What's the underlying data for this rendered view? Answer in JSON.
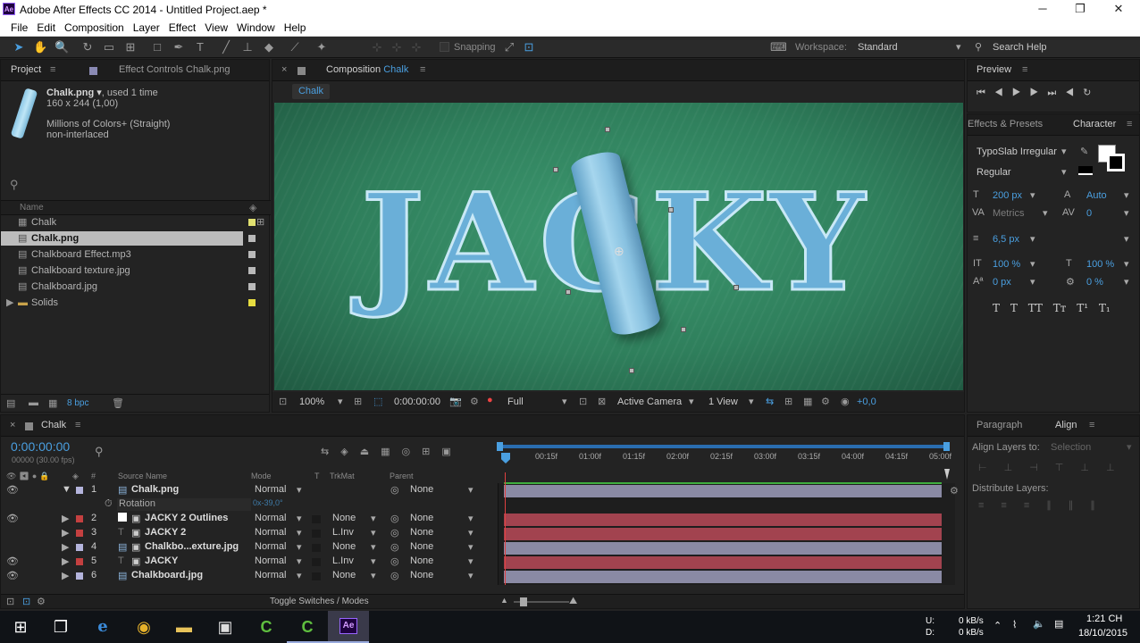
{
  "window": {
    "app_icon": "Ae",
    "title": "Adobe After Effects CC 2014 - Untitled Project.aep *",
    "minimize": "─",
    "restore": "❐",
    "close": "✕"
  },
  "menu": [
    "File",
    "Edit",
    "Composition",
    "Layer",
    "Effect",
    "View",
    "Window",
    "Help"
  ],
  "toolbar": {
    "snapping": "Snapping",
    "workspace_label": "Workspace:",
    "workspace_value": "Standard",
    "search_help": "Search Help"
  },
  "project": {
    "tab_project": "Project",
    "tab_effect_controls": "Effect Controls Chalk.png",
    "file_name": "Chalk.png",
    "used": ", used 1 time",
    "dims": "160 x 244 (1,00)",
    "colors": "Millions of Colors+ (Straight)",
    "interlace": "non-interlaced",
    "col_name": "Name",
    "items": [
      {
        "name": "Chalk",
        "color": "#e0e070"
      },
      {
        "name": "Chalk.png",
        "color": "#b9b9b9"
      },
      {
        "name": "Chalkboard Effect.mp3",
        "color": "#b9b9b9"
      },
      {
        "name": "Chalkboard texture.jpg",
        "color": "#b9b9b9"
      },
      {
        "name": "Chalkboard.jpg",
        "color": "#b9b9b9"
      },
      {
        "name": "Solids",
        "color": "#e6dc40"
      }
    ],
    "bpc": "8 bpc"
  },
  "composition": {
    "tab_label": "Composition",
    "tab_name": "Chalk",
    "crumb": "Chalk",
    "canvas_text": "JACKY",
    "zoom": "100%",
    "timecode": "0:00:00:00",
    "resolution": "Full",
    "camera": "Active Camera",
    "views": "1 View",
    "exposure": "+0,0"
  },
  "preview": {
    "tab": "Preview"
  },
  "effects_presets": {
    "tab": "Effects & Presets"
  },
  "character": {
    "tab": "Character",
    "font": "TypoSlab Irregular",
    "style": "Regular",
    "size": "200 px",
    "leading": "Auto",
    "kerning": "Metrics",
    "tracking": "0",
    "stroke": "6,5 px",
    "vscale": "100 %",
    "hscale": "100 %",
    "baseline": "0 px",
    "tsume": "0 %"
  },
  "paragraph": {
    "tab": "Paragraph"
  },
  "align": {
    "tab": "Align",
    "align_to_label": "Align Layers to:",
    "align_to_value": "Selection",
    "distribute": "Distribute Layers:"
  },
  "timeline": {
    "tab": "Chalk",
    "timecode": "0:00:00:00",
    "fps": "00000 (30.00 fps)",
    "col_source": "Source Name",
    "col_mode": "Mode",
    "col_t": "T",
    "col_trkmat": "TrkMat",
    "col_parent": "Parent",
    "col_hash": "#",
    "ruler": [
      "00:15f",
      "01:00f",
      "01:15f",
      "02:00f",
      "02:15f",
      "03:00f",
      "03:15f",
      "04:00f",
      "04:15f",
      "05:00f"
    ],
    "rotation_label": "Rotation",
    "rotation_value": "0x-39,0°",
    "toggle": "Toggle Switches / Modes",
    "layers": [
      {
        "num": "1",
        "name": "Chalk.png",
        "mode": "Normal",
        "trkmat": "",
        "parent": "None",
        "label": "#b4b4dc",
        "bar": "#8a8aa4"
      },
      {
        "num": "2",
        "name": "JACKY 2 Outlines",
        "mode": "Normal",
        "trkmat": "None",
        "parent": "None",
        "label": "#c44040",
        "bar": "#a2434f"
      },
      {
        "num": "3",
        "name": "JACKY 2",
        "mode": "Normal",
        "trkmat": "L.Inv",
        "parent": "None",
        "label": "#c44040",
        "bar": "#a2434f"
      },
      {
        "num": "4",
        "name": "Chalkbo...exture.jpg",
        "mode": "Normal",
        "trkmat": "None",
        "parent": "None",
        "label": "#b4b4dc",
        "bar": "#8a8aa4"
      },
      {
        "num": "5",
        "name": "JACKY",
        "mode": "Normal",
        "trkmat": "L.Inv",
        "parent": "None",
        "label": "#c44040",
        "bar": "#a2434f"
      },
      {
        "num": "6",
        "name": "Chalkboard.jpg",
        "mode": "Normal",
        "trkmat": "None",
        "parent": "None",
        "label": "#b4b4dc",
        "bar": "#8a8aa4"
      }
    ]
  },
  "taskbar": {
    "net_u": "U:",
    "net_d": "D:",
    "up_rate": "0 kB/s",
    "down_rate": "0 kB/s",
    "time": "1:21 CH",
    "date": "18/10/2015"
  }
}
